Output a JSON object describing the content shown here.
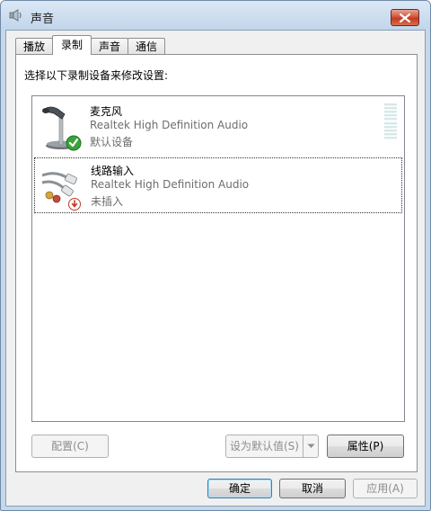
{
  "window": {
    "title": "声音",
    "close_label": "×"
  },
  "tabs": [
    {
      "label": "播放",
      "active": false
    },
    {
      "label": "录制",
      "active": true
    },
    {
      "label": "声音",
      "active": false
    },
    {
      "label": "通信",
      "active": false
    }
  ],
  "recording": {
    "instruction": "选择以下录制设备来修改设置:",
    "devices": [
      {
        "name": "麦克风",
        "driver": "Realtek High Definition Audio",
        "status": "默认设备",
        "icon": "microphone-icon",
        "badge": "default-check-icon"
      },
      {
        "name": "线路输入",
        "driver": "Realtek High Definition Audio",
        "status": "未插入",
        "icon": "line-in-cable-icon",
        "badge": "unplugged-icon"
      }
    ]
  },
  "buttons": {
    "configure": "配置(C)",
    "set_default": "设为默认值(S)",
    "properties": "属性(P)",
    "ok": "确定",
    "cancel": "取消",
    "apply": "应用(A)"
  },
  "colors": {
    "accent": "#3c7fb1",
    "check": "#3aa43a",
    "unplugged": "#c0392b"
  }
}
